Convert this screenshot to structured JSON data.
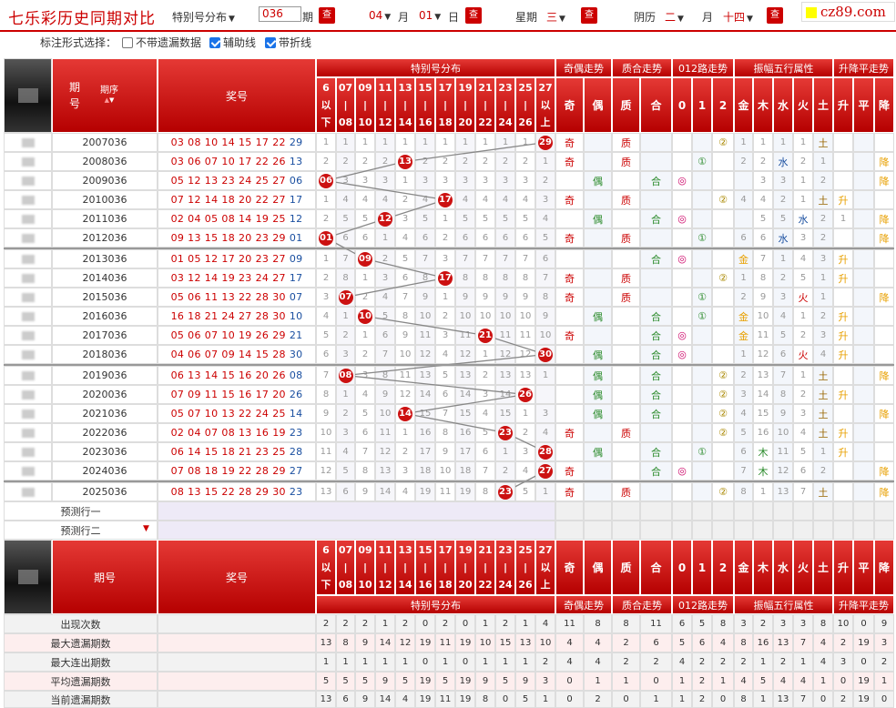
{
  "header": {
    "title": "七乐彩历史同期对比",
    "mode": "特别号分布",
    "period_value": "036",
    "period_suffix": "期",
    "month": "04",
    "month_suffix": "月",
    "day": "01",
    "day_suffix": "日",
    "week_label": "星期",
    "week": "三",
    "lunar_label": "阴历",
    "lunar_month": "二",
    "lunar_month_suffix": "月",
    "lunar_day": "十四",
    "query": "查",
    "logo": "cz89.com"
  },
  "options": {
    "label": "标注形式选择：",
    "o1": "不带遗漏数据",
    "o1_checked": false,
    "o2": "辅助线",
    "o2_checked": true,
    "o3": "带折线",
    "o3_checked": true
  },
  "columns": {
    "period": "期号",
    "period_top": "期",
    "period_bot": "号",
    "sort": "期序",
    "award": "奖号",
    "ranges": [
      [
        "6",
        "以",
        "下"
      ],
      [
        "07",
        "|",
        "08"
      ],
      [
        "09",
        "|",
        "10"
      ],
      [
        "11",
        "|",
        "12"
      ],
      [
        "13",
        "|",
        "14"
      ],
      [
        "15",
        "|",
        "16"
      ],
      [
        "17",
        "|",
        "18"
      ],
      [
        "19",
        "|",
        "20"
      ],
      [
        "21",
        "|",
        "22"
      ],
      [
        "23",
        "|",
        "24"
      ],
      [
        "25",
        "|",
        "26"
      ],
      [
        "27",
        "以",
        "上"
      ]
    ],
    "groups": [
      "特别号分布",
      "奇偶走势",
      "质合走势",
      "012路走势",
      "振幅五行属性",
      "升降平走势"
    ],
    "subs": [
      "奇",
      "偶",
      "质",
      "合",
      "0",
      "1",
      "2",
      "金",
      "木",
      "水",
      "火",
      "土",
      "升",
      "平",
      "降"
    ]
  },
  "rows": [
    {
      "p": "2007036",
      "n": [
        "03",
        "08",
        "10",
        "14",
        "15",
        "17",
        "22"
      ],
      "s": "29",
      "b": 11,
      "m": [
        "1",
        "1",
        "1",
        "1",
        "1",
        "1",
        "1",
        "1",
        "1",
        "1",
        "1",
        ""
      ],
      "a": [
        "奇",
        "",
        "质",
        "",
        "",
        "",
        "②",
        "1",
        "1",
        "1",
        "1",
        "土",
        "",
        "",
        ""
      ]
    },
    {
      "p": "2008036",
      "n": [
        "03",
        "06",
        "07",
        "10",
        "17",
        "22",
        "26"
      ],
      "s": "13",
      "b": 4,
      "m": [
        "2",
        "2",
        "2",
        "2",
        "",
        "2",
        "2",
        "2",
        "2",
        "2",
        "2",
        "1"
      ],
      "a": [
        "奇",
        "",
        "质",
        "",
        "",
        "①",
        "",
        "2",
        "2",
        "水",
        "2",
        "1",
        "",
        "",
        "降"
      ]
    },
    {
      "p": "2009036",
      "n": [
        "05",
        "12",
        "13",
        "23",
        "24",
        "25",
        "27"
      ],
      "s": "06",
      "b": 0,
      "m": [
        "",
        "3",
        "3",
        "3",
        "1",
        "3",
        "3",
        "3",
        "3",
        "3",
        "3",
        "2"
      ],
      "a": [
        "",
        "偶",
        "",
        "合",
        "◎",
        "",
        "",
        "",
        "3",
        "3",
        "1",
        "2",
        "",
        "",
        "降"
      ]
    },
    {
      "p": "2010036",
      "n": [
        "07",
        "12",
        "14",
        "18",
        "20",
        "22",
        "27"
      ],
      "s": "17",
      "b": 6,
      "m": [
        "1",
        "4",
        "4",
        "4",
        "2",
        "4",
        "",
        "4",
        "4",
        "4",
        "4",
        "3"
      ],
      "a": [
        "奇",
        "",
        "质",
        "",
        "",
        "",
        "②",
        "4",
        "4",
        "2",
        "1",
        "土",
        "升",
        "",
        ""
      ]
    },
    {
      "p": "2011036",
      "n": [
        "02",
        "04",
        "05",
        "08",
        "14",
        "19",
        "25"
      ],
      "s": "12",
      "b": 3,
      "m": [
        "2",
        "5",
        "5",
        "",
        "3",
        "5",
        "1",
        "5",
        "5",
        "5",
        "5",
        "4"
      ],
      "a": [
        "",
        "偶",
        "",
        "合",
        "◎",
        "",
        "",
        "",
        "5",
        "5",
        "水",
        "2",
        "1",
        "",
        "降"
      ]
    },
    {
      "p": "2012036",
      "n": [
        "09",
        "13",
        "15",
        "18",
        "20",
        "23",
        "29"
      ],
      "s": "01",
      "b": 0,
      "m": [
        "",
        "6",
        "6",
        "1",
        "4",
        "6",
        "2",
        "6",
        "6",
        "6",
        "6",
        "5"
      ],
      "a": [
        "奇",
        "",
        "质",
        "",
        "",
        "①",
        "",
        "6",
        "6",
        "水",
        "3",
        "2",
        "",
        "",
        "降"
      ]
    },
    {
      "p": "2013036",
      "n": [
        "01",
        "05",
        "12",
        "17",
        "20",
        "23",
        "27"
      ],
      "s": "09",
      "b": 2,
      "m": [
        "1",
        "7",
        "",
        "2",
        "5",
        "7",
        "3",
        "7",
        "7",
        "7",
        "7",
        "6"
      ],
      "a": [
        "",
        "",
        "",
        "合",
        "◎",
        "",
        "",
        "金",
        "7",
        "1",
        "4",
        "3",
        "升",
        "",
        ""
      ]
    },
    {
      "p": "2014036",
      "n": [
        "03",
        "12",
        "14",
        "19",
        "23",
        "24",
        "27"
      ],
      "s": "17",
      "b": 6,
      "m": [
        "2",
        "8",
        "1",
        "3",
        "6",
        "8",
        "",
        "8",
        "8",
        "8",
        "8",
        "7"
      ],
      "a": [
        "奇",
        "",
        "质",
        "",
        "",
        "",
        "②",
        "1",
        "8",
        "2",
        "5",
        "1",
        "升",
        "",
        ""
      ]
    },
    {
      "p": "2015036",
      "n": [
        "05",
        "06",
        "11",
        "13",
        "22",
        "28",
        "30"
      ],
      "s": "07",
      "b": 1,
      "m": [
        "3",
        "",
        "2",
        "4",
        "7",
        "9",
        "1",
        "9",
        "9",
        "9",
        "9",
        "8"
      ],
      "a": [
        "奇",
        "",
        "质",
        "",
        "",
        "①",
        "",
        "2",
        "9",
        "3",
        "火",
        "1",
        "",
        "",
        "降"
      ]
    },
    {
      "p": "2016036",
      "n": [
        "16",
        "18",
        "21",
        "24",
        "27",
        "28",
        "30"
      ],
      "s": "10",
      "b": 2,
      "m": [
        "4",
        "1",
        "",
        "5",
        "8",
        "10",
        "2",
        "10",
        "10",
        "10",
        "10",
        "9"
      ],
      "a": [
        "",
        "偶",
        "",
        "合",
        "",
        "①",
        "",
        "金",
        "10",
        "4",
        "1",
        "2",
        "升",
        "",
        ""
      ]
    },
    {
      "p": "2017036",
      "n": [
        "05",
        "06",
        "07",
        "10",
        "19",
        "26",
        "29"
      ],
      "s": "21",
      "b": 8,
      "m": [
        "5",
        "2",
        "1",
        "6",
        "9",
        "11",
        "3",
        "11",
        "",
        "11",
        "11",
        "10"
      ],
      "a": [
        "奇",
        "",
        "",
        "合",
        "◎",
        "",
        "",
        "金",
        "11",
        "5",
        "2",
        "3",
        "升",
        "",
        ""
      ]
    },
    {
      "p": "2018036",
      "n": [
        "04",
        "06",
        "07",
        "09",
        "14",
        "15",
        "28"
      ],
      "s": "30",
      "b": 11,
      "m": [
        "6",
        "3",
        "2",
        "7",
        "10",
        "12",
        "4",
        "12",
        "1",
        "12",
        "12",
        ""
      ],
      "a": [
        "",
        "偶",
        "",
        "合",
        "◎",
        "",
        "",
        "1",
        "12",
        "6",
        "火",
        "4",
        "升",
        "",
        ""
      ]
    },
    {
      "p": "2019036",
      "n": [
        "06",
        "13",
        "14",
        "15",
        "16",
        "20",
        "26"
      ],
      "s": "08",
      "b": 1,
      "m": [
        "7",
        "",
        "3",
        "8",
        "11",
        "13",
        "5",
        "13",
        "2",
        "13",
        "13",
        "1"
      ],
      "a": [
        "",
        "偶",
        "",
        "合",
        "",
        "",
        "②",
        "2",
        "13",
        "7",
        "1",
        "土",
        "",
        "",
        "降"
      ]
    },
    {
      "p": "2020036",
      "n": [
        "07",
        "09",
        "11",
        "15",
        "16",
        "17",
        "20"
      ],
      "s": "26",
      "b": 10,
      "m": [
        "8",
        "1",
        "4",
        "9",
        "12",
        "14",
        "6",
        "14",
        "3",
        "14",
        "",
        ""
      ],
      "a": [
        "",
        "偶",
        "",
        "合",
        "",
        "",
        "②",
        "3",
        "14",
        "8",
        "2",
        "土",
        "升",
        "",
        ""
      ]
    },
    {
      "p": "2021036",
      "n": [
        "05",
        "07",
        "10",
        "13",
        "22",
        "24",
        "25"
      ],
      "s": "14",
      "b": 4,
      "m": [
        "9",
        "2",
        "5",
        "10",
        "",
        "15",
        "7",
        "15",
        "4",
        "15",
        "1",
        "3"
      ],
      "a": [
        "",
        "偶",
        "",
        "合",
        "",
        "",
        "②",
        "4",
        "15",
        "9",
        "3",
        "土",
        "",
        "",
        "降"
      ]
    },
    {
      "p": "2022036",
      "n": [
        "02",
        "04",
        "07",
        "08",
        "13",
        "16",
        "19"
      ],
      "s": "23",
      "b": 9,
      "m": [
        "10",
        "3",
        "6",
        "11",
        "1",
        "16",
        "8",
        "16",
        "5",
        "",
        "2",
        "4"
      ],
      "a": [
        "奇",
        "",
        "质",
        "",
        "",
        "",
        "②",
        "5",
        "16",
        "10",
        "4",
        "土",
        "升",
        "",
        ""
      ]
    },
    {
      "p": "2023036",
      "n": [
        "06",
        "14",
        "15",
        "18",
        "21",
        "23",
        "25"
      ],
      "s": "28",
      "b": 11,
      "m": [
        "11",
        "4",
        "7",
        "12",
        "2",
        "17",
        "9",
        "17",
        "6",
        "1",
        "3",
        ""
      ],
      "a": [
        "",
        "偶",
        "",
        "合",
        "",
        "①",
        "",
        "6",
        "木",
        "11",
        "5",
        "1",
        "升",
        "",
        ""
      ]
    },
    {
      "p": "2024036",
      "n": [
        "07",
        "08",
        "18",
        "19",
        "22",
        "28",
        "29"
      ],
      "s": "27",
      "b": 11,
      "m": [
        "12",
        "5",
        "8",
        "13",
        "3",
        "18",
        "10",
        "18",
        "7",
        "2",
        "4",
        ""
      ],
      "a": [
        "奇",
        "",
        "",
        "合",
        "◎",
        "",
        "",
        "7",
        "木",
        "12",
        "6",
        "2",
        "",
        "",
        "降"
      ]
    },
    {
      "p": "2025036",
      "n": [
        "08",
        "13",
        "15",
        "22",
        "28",
        "29",
        "30"
      ],
      "s": "23",
      "b": 9,
      "m": [
        "13",
        "6",
        "9",
        "14",
        "4",
        "19",
        "11",
        "19",
        "8",
        "",
        "5",
        "1"
      ],
      "a": [
        "奇",
        "",
        "质",
        "",
        "",
        "",
        "②",
        "8",
        "1",
        "13",
        "7",
        "土",
        "",
        "",
        "降"
      ]
    }
  ],
  "predict": [
    "预测行一",
    "预测行二"
  ],
  "stats": [
    {
      "label": "出现次数",
      "v": [
        "2",
        "2",
        "2",
        "1",
        "2",
        "0",
        "2",
        "0",
        "1",
        "2",
        "1",
        "4",
        "11",
        "8",
        "8",
        "11",
        "6",
        "5",
        "8",
        "3",
        "2",
        "3",
        "3",
        "8",
        "10",
        "0",
        "9"
      ]
    },
    {
      "label": "最大遗漏期数",
      "v": [
        "13",
        "8",
        "9",
        "14",
        "12",
        "19",
        "11",
        "19",
        "10",
        "15",
        "13",
        "10",
        "4",
        "4",
        "2",
        "6",
        "5",
        "6",
        "4",
        "8",
        "16",
        "13",
        "7",
        "4",
        "2",
        "19",
        "3"
      ]
    },
    {
      "label": "最大连出期数",
      "v": [
        "1",
        "1",
        "1",
        "1",
        "1",
        "0",
        "1",
        "0",
        "1",
        "1",
        "1",
        "2",
        "4",
        "4",
        "2",
        "2",
        "4",
        "2",
        "2",
        "2",
        "1",
        "2",
        "1",
        "4",
        "3",
        "0",
        "2"
      ]
    },
    {
      "label": "平均遗漏期数",
      "v": [
        "5",
        "5",
        "5",
        "9",
        "5",
        "19",
        "5",
        "19",
        "9",
        "5",
        "9",
        "3",
        "0",
        "1",
        "1",
        "0",
        "1",
        "2",
        "1",
        "4",
        "5",
        "4",
        "4",
        "1",
        "0",
        "19",
        "1"
      ]
    },
    {
      "label": "当前遗漏期数",
      "v": [
        "13",
        "6",
        "9",
        "14",
        "4",
        "19",
        "11",
        "19",
        "8",
        "0",
        "5",
        "1",
        "0",
        "2",
        "0",
        "1",
        "1",
        "2",
        "0",
        "8",
        "1",
        "13",
        "7",
        "0",
        "2",
        "19",
        "0"
      ]
    }
  ],
  "colors": {
    "red": "#cc0000",
    "ball": "#cc1111",
    "blue": "#1a4fa0",
    "orange": "#e8a000",
    "green": "#2a8a2a"
  }
}
